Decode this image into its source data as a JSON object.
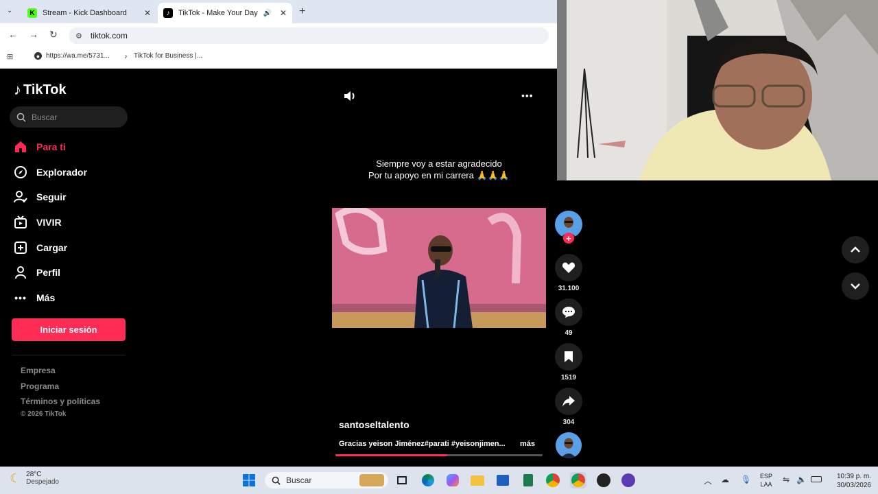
{
  "browser": {
    "tabs": [
      {
        "label": "Stream - Kick Dashboard",
        "active": false
      },
      {
        "label": "TikTok - Make Your Day",
        "active": true
      }
    ],
    "url": "tiktok.com",
    "bookmarks": [
      "https://wa.me/5731...",
      "TikTok for Business |..."
    ]
  },
  "sidebar": {
    "brand": "TikTok",
    "search_placeholder": "Buscar",
    "items": [
      {
        "label": "Para ti",
        "icon": "home-icon",
        "active": true
      },
      {
        "label": "Explorador",
        "icon": "compass-icon"
      },
      {
        "label": "Seguir",
        "icon": "follow-user-icon"
      },
      {
        "label": "VIVIR",
        "icon": "live-tv-icon"
      },
      {
        "label": "Cargar",
        "icon": "upload-plus-icon"
      },
      {
        "label": "Perfil",
        "icon": "profile-icon"
      },
      {
        "label": "Más",
        "icon": "more-dots-icon"
      }
    ],
    "login_label": "Iniciar sesión",
    "footer": [
      "Empresa",
      "Programa",
      "Términos y políticas",
      "© 2026 TikTok"
    ]
  },
  "video": {
    "caption_line1": "Siempre voy a estar agradecido",
    "caption_line2": "Por tu apoyo en mi carrera 🙏🙏🙏",
    "author": "santoseltalento",
    "description": "Gracias yeison Jiménez#parati #yeisonjimen...",
    "more_label": "más",
    "progress": 0.54,
    "likes": "31.100",
    "comments": "49",
    "saves": "1519",
    "shares": "304"
  },
  "taskbar": {
    "temperature": "28°C",
    "weather": "Despejado",
    "search": "Buscar",
    "lang1": "ESP",
    "lang2": "LAA",
    "time": "10:39 p. m.",
    "date": "30/03/2026"
  },
  "colors": {
    "accent": "#fe2c55",
    "background": "#000000"
  }
}
